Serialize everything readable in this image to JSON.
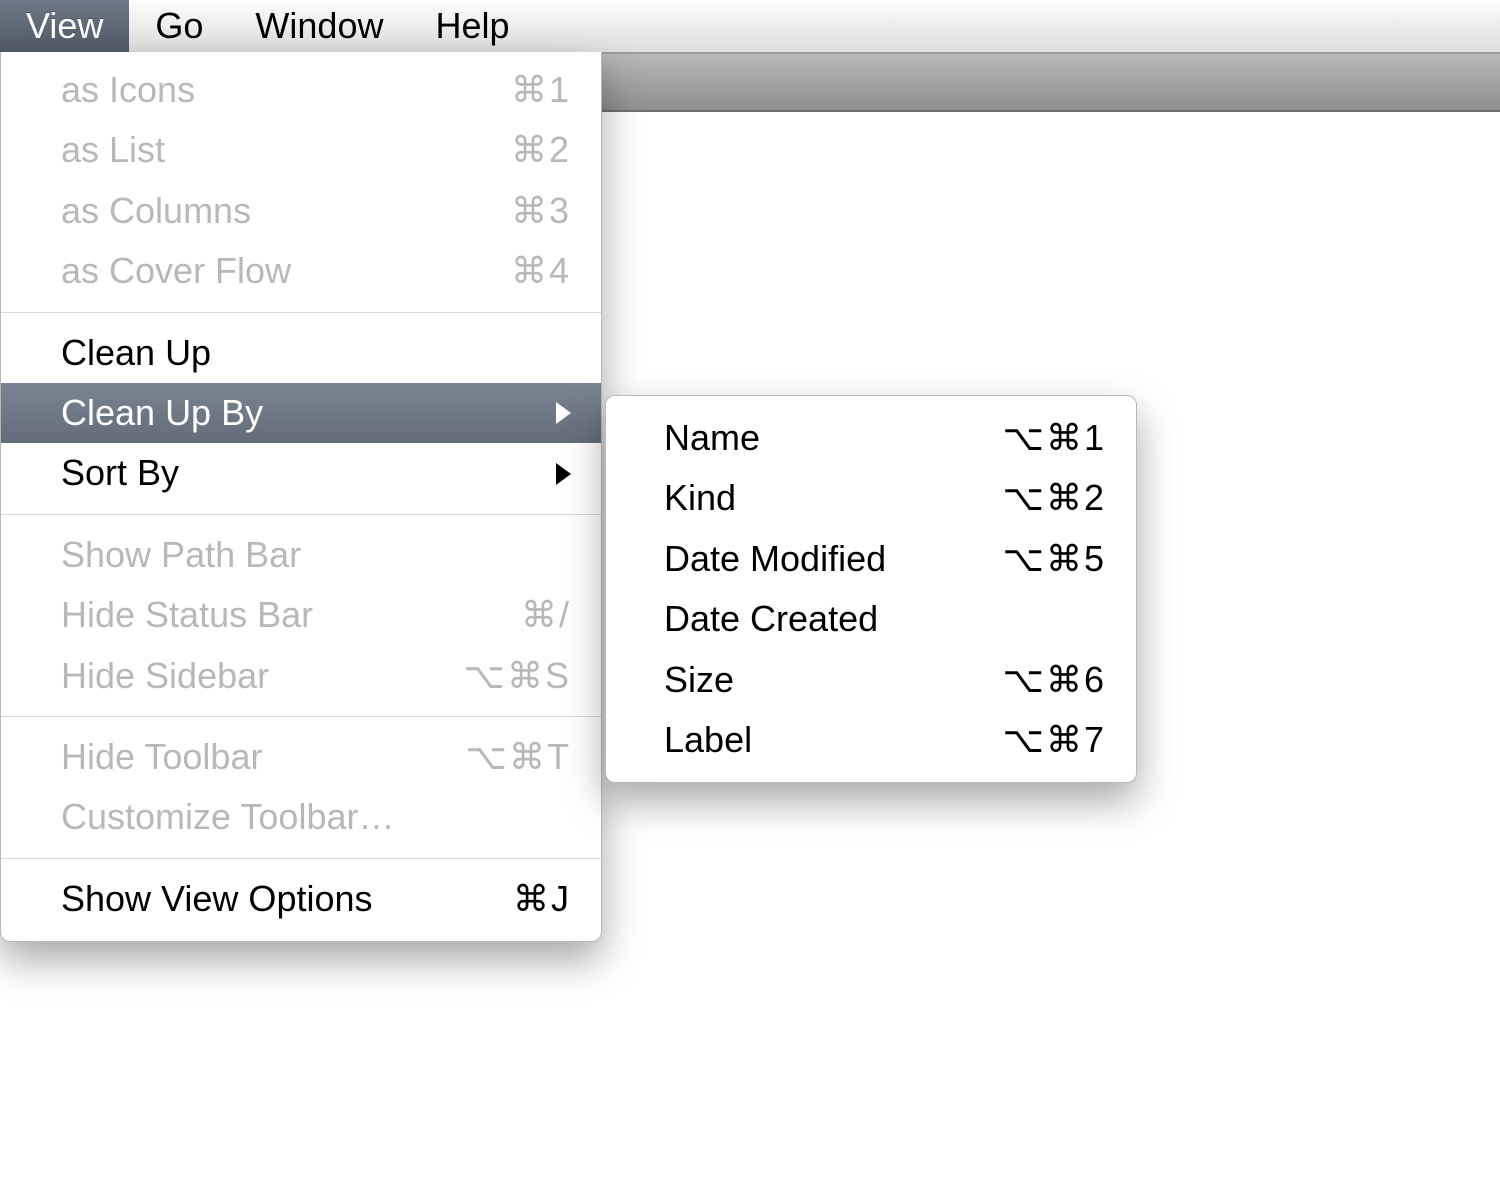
{
  "menubar": {
    "items": [
      {
        "label": "View"
      },
      {
        "label": "Go"
      },
      {
        "label": "Window"
      },
      {
        "label": "Help"
      }
    ]
  },
  "viewMenu": {
    "items": [
      {
        "label": "as Icons",
        "shortcut": "⌘1",
        "disabled": true
      },
      {
        "label": "as List",
        "shortcut": "⌘2",
        "disabled": true
      },
      {
        "label": "as Columns",
        "shortcut": "⌘3",
        "disabled": true
      },
      {
        "label": "as Cover Flow",
        "shortcut": "⌘4",
        "disabled": true
      },
      {
        "sep": true
      },
      {
        "label": "Clean Up",
        "shortcut": ""
      },
      {
        "label": "Clean Up By",
        "submenu": true,
        "highlight": true
      },
      {
        "label": "Sort By",
        "submenu": true
      },
      {
        "sep": true
      },
      {
        "label": "Show Path Bar",
        "shortcut": "",
        "disabled": true
      },
      {
        "label": "Hide Status Bar",
        "shortcut": "⌘/",
        "disabled": true
      },
      {
        "label": "Hide Sidebar",
        "shortcut": "⌥⌘S",
        "disabled": true
      },
      {
        "sep": true
      },
      {
        "label": "Hide Toolbar",
        "shortcut": "⌥⌘T",
        "disabled": true
      },
      {
        "label": "Customize Toolbar…",
        "shortcut": "",
        "disabled": true
      },
      {
        "sep": true
      },
      {
        "label": "Show View Options",
        "shortcut": "⌘J"
      }
    ]
  },
  "cleanUpBySubmenu": {
    "items": [
      {
        "label": "Name",
        "shortcut": "⌥⌘1"
      },
      {
        "label": "Kind",
        "shortcut": "⌥⌘2"
      },
      {
        "label": "Date Modified",
        "shortcut": "⌥⌘5"
      },
      {
        "label": "Date Created",
        "shortcut": ""
      },
      {
        "label": "Size",
        "shortcut": "⌥⌘6"
      },
      {
        "label": "Label",
        "shortcut": "⌥⌘7"
      }
    ]
  }
}
